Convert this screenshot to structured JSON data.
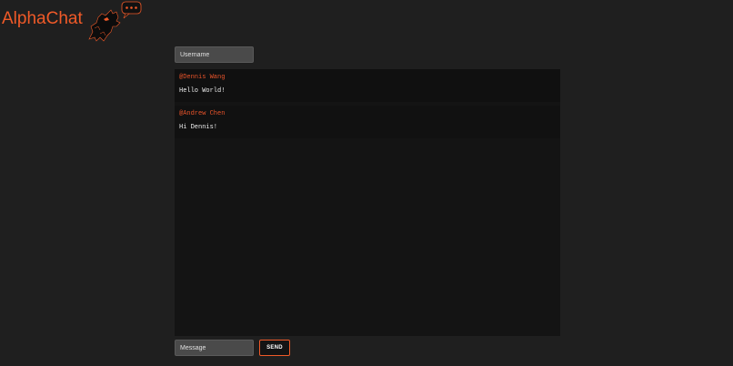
{
  "brand": {
    "name": "AlphaChat",
    "logo_icon": "wolf-speech-bubble-icon",
    "color": "#f05a28"
  },
  "username": {
    "placeholder": "Username",
    "value": ""
  },
  "messages": [
    {
      "author": "@Dennis Wang",
      "text": "Hello World!"
    },
    {
      "author": "@Andrew Chen",
      "text": "Hi Dennis!"
    }
  ],
  "composer": {
    "placeholder": "Message",
    "value": "",
    "send_label": "SEND"
  },
  "colors": {
    "background": "#1f1f1f",
    "chat_background": "#141414",
    "accent": "#f05a28",
    "input_background": "#4a4a4a"
  }
}
